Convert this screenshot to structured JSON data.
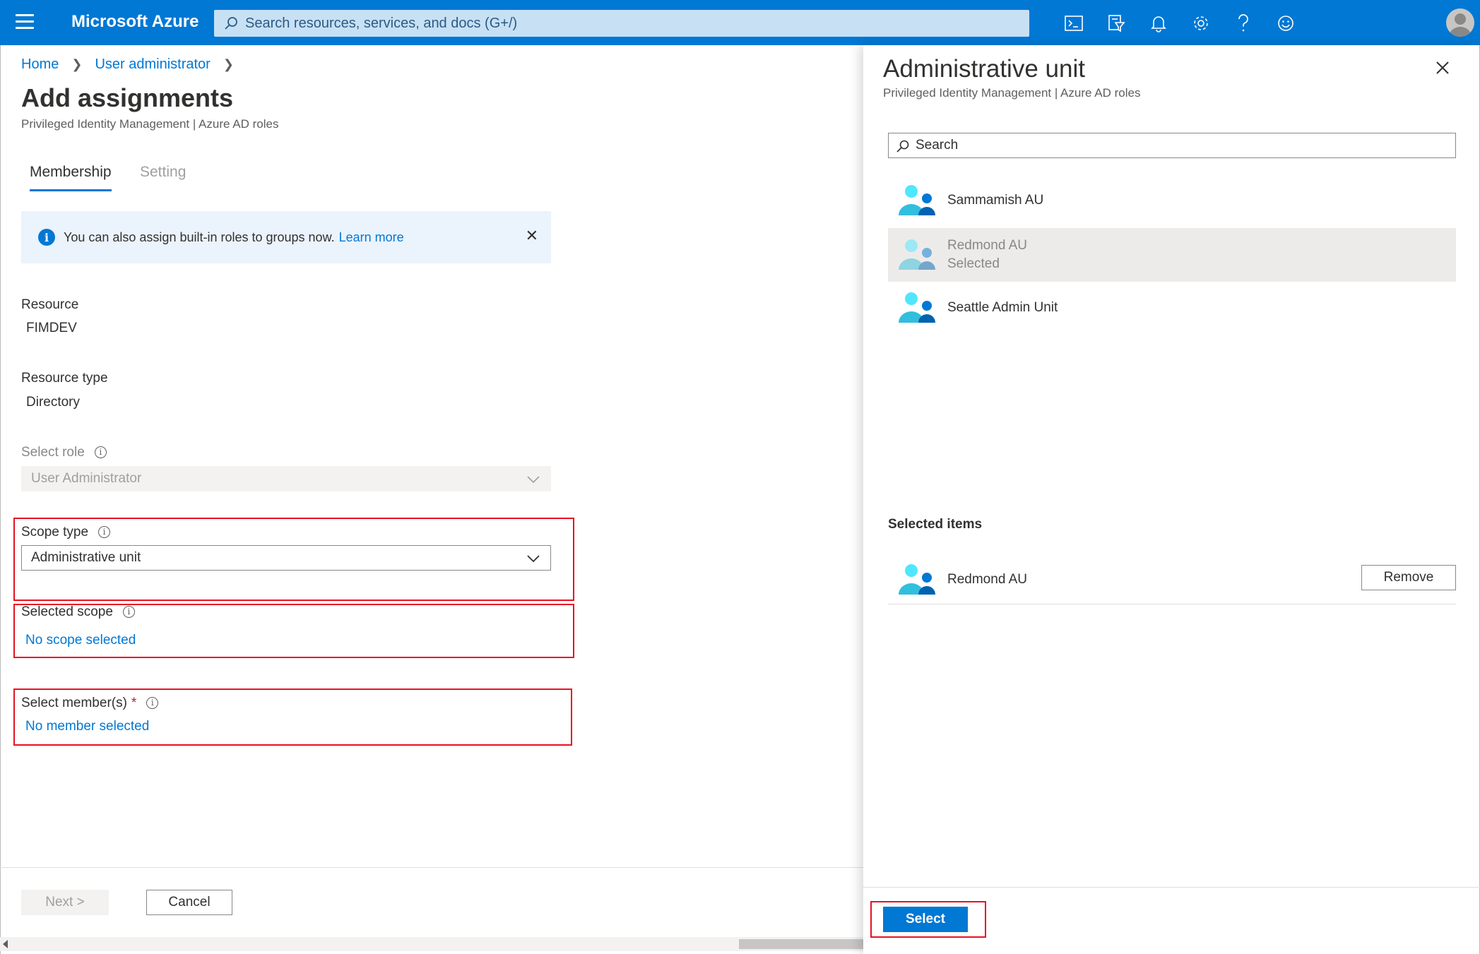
{
  "header": {
    "brand": "Microsoft Azure",
    "search_placeholder": "Search resources, services, and docs (G+/)",
    "icons": [
      "cloud-shell-icon",
      "directory-filter-icon",
      "notifications-icon",
      "settings-icon",
      "help-icon",
      "feedback-icon"
    ]
  },
  "breadcrumb": {
    "items": [
      "Home",
      "User administrator"
    ]
  },
  "page": {
    "title": "Add assignments",
    "subtitle": "Privileged Identity Management | Azure AD roles",
    "tabs": [
      "Membership",
      "Setting"
    ],
    "active_tab": "Membership",
    "info_banner": {
      "text": "You can also assign built-in roles to groups now.",
      "link": "Learn more"
    },
    "resource": {
      "label": "Resource",
      "value": "FIMDEV"
    },
    "resource_type": {
      "label": "Resource type",
      "value": "Directory"
    },
    "select_role": {
      "label": "Select role",
      "value": "User Administrator"
    },
    "scope_type": {
      "label": "Scope type",
      "value": "Administrative unit"
    },
    "selected_scope": {
      "label": "Selected scope",
      "value": "No scope selected"
    },
    "select_members": {
      "label": "Select member(s)",
      "required": "*",
      "value": "No member selected"
    },
    "buttons": {
      "next": "Next >",
      "cancel": "Cancel"
    }
  },
  "panel": {
    "title": "Administrative unit",
    "subtitle": "Privileged Identity Management | Azure AD roles",
    "search_placeholder": "Search",
    "items": [
      {
        "name": "Sammamish AU",
        "status": ""
      },
      {
        "name": "Redmond AU",
        "status": "Selected"
      },
      {
        "name": "Seattle Admin Unit",
        "status": ""
      }
    ],
    "selected_heading": "Selected items",
    "selected": [
      {
        "name": "Redmond AU",
        "action": "Remove"
      }
    ],
    "select_button": "Select"
  },
  "colors": {
    "accent": "#0078d4",
    "highlight": "#e81123",
    "selected_row": "#edebe9"
  }
}
